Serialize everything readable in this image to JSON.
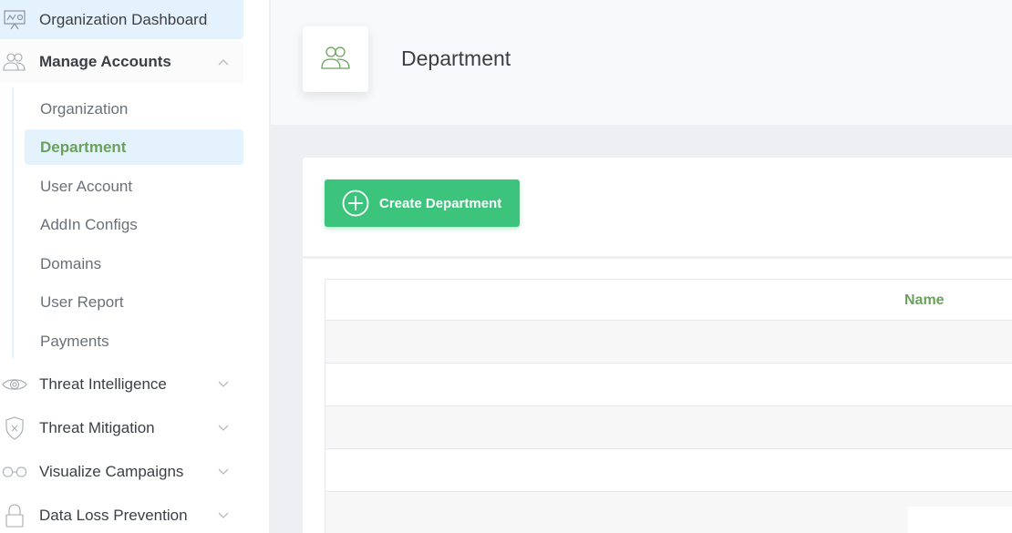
{
  "sidebar": {
    "items": [
      {
        "label": "Organization Dashboard",
        "icon": "presentation-board-icon"
      },
      {
        "label": "Manage Accounts",
        "icon": "users-icon",
        "expanded": true
      },
      {
        "label": "Threat Intelligence",
        "icon": "eye-icon"
      },
      {
        "label": "Threat Mitigation",
        "icon": "shield-x-icon"
      },
      {
        "label": "Visualize Campaigns",
        "icon": "glasses-icon"
      },
      {
        "label": "Data Loss Prevention",
        "icon": "lock-icon"
      }
    ],
    "submenu": [
      {
        "label": "Organization"
      },
      {
        "label": "Department",
        "active": true
      },
      {
        "label": "User Account"
      },
      {
        "label": "AddIn Configs"
      },
      {
        "label": "Domains"
      },
      {
        "label": "User Report"
      },
      {
        "label": "Payments"
      }
    ]
  },
  "header": {
    "title": "Department",
    "icon": "users-icon"
  },
  "toolbar": {
    "create_label": "Create Department"
  },
  "table": {
    "columns": [
      "Name"
    ],
    "rows": [
      [
        ""
      ],
      [
        ""
      ],
      [
        ""
      ],
      [
        ""
      ],
      [
        ""
      ]
    ]
  },
  "colors": {
    "accent_green": "#3cc47c",
    "active_text": "#6aa25a",
    "active_bg": "#e4f2fd"
  }
}
